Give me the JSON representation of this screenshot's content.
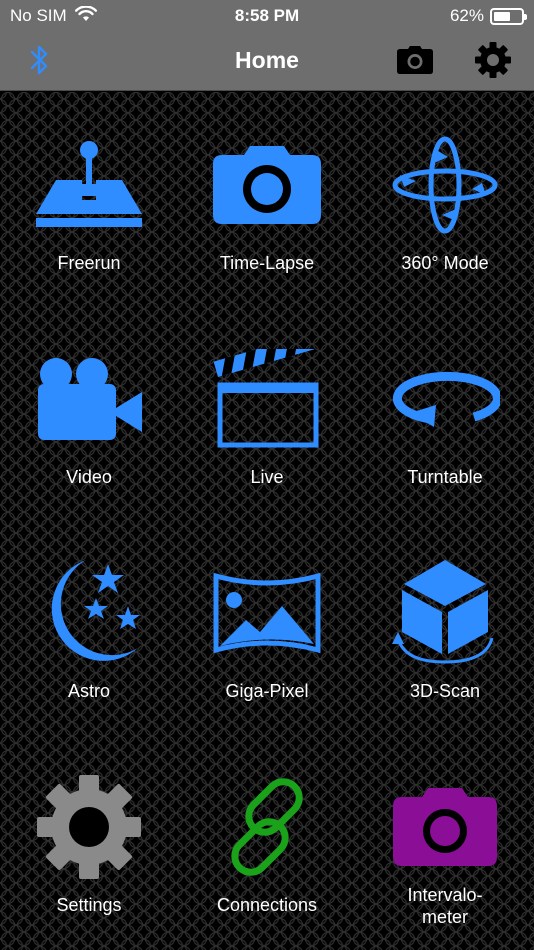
{
  "status": {
    "carrier": "No SIM",
    "time": "8:58 PM",
    "battery": "62%",
    "battery_level": 0.62
  },
  "nav": {
    "title": "Home",
    "left_icon": "bluetooth-icon",
    "right_icons": [
      "camera-icon",
      "gear-icon"
    ]
  },
  "colors": {
    "accent": "#2f8dff",
    "bar": "#6e6e6e",
    "settings_gray": "#8a8a8a",
    "connections_green": "#1aa31a",
    "intervalometer_purple": "#8a0e96"
  },
  "modes": [
    {
      "label": "Freerun",
      "icon": "joystick-icon"
    },
    {
      "label": "Time-Lapse",
      "icon": "camera-icon"
    },
    {
      "label": "360° Mode",
      "icon": "rotation-axes-icon"
    },
    {
      "label": "Video",
      "icon": "video-camera-icon"
    },
    {
      "label": "Live",
      "icon": "clapperboard-icon"
    },
    {
      "label": "Turntable",
      "icon": "turntable-icon"
    },
    {
      "label": "Astro",
      "icon": "moon-stars-icon"
    },
    {
      "label": "Giga-Pixel",
      "icon": "panorama-icon"
    },
    {
      "label": "3D-Scan",
      "icon": "cube-rotate-icon"
    },
    {
      "label": "Settings",
      "icon": "gear-icon"
    },
    {
      "label": "Connections",
      "icon": "chain-link-icon"
    },
    {
      "label": "Intervalo-\nmeter",
      "icon": "camera-icon"
    }
  ]
}
